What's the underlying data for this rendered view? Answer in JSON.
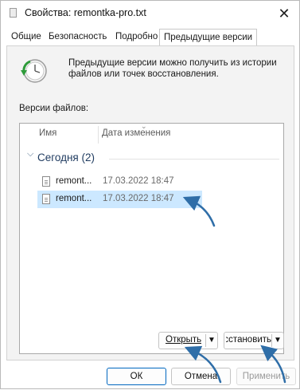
{
  "window": {
    "title": "Свойства: remontka-pro.txt",
    "close_glyph": "✕"
  },
  "tabs": [
    {
      "label": "Общие"
    },
    {
      "label": "Безопасность"
    },
    {
      "label": "Подробно"
    },
    {
      "label": "Предыдущие версии",
      "active": true
    }
  ],
  "panel": {
    "description": "Предыдущие версии можно получить из истории файлов или точек восстановления.",
    "versions_label": "Версии файлов:",
    "columns": [
      "Имя",
      "Дата изменения"
    ],
    "group": {
      "label": "Сегодня (2)"
    },
    "rows": [
      {
        "name": "remont...",
        "date": "17.03.2022 18:47",
        "selected": false
      },
      {
        "name": "remont...",
        "date": "17.03.2022 18:47",
        "selected": true
      }
    ],
    "open_button": "Открыть",
    "restore_button": "Восстановить"
  },
  "footer": {
    "ok": "ОК",
    "cancel": "Отмена",
    "apply": "Применить"
  },
  "colors": {
    "accent": "#0067c0",
    "selection": "#cce8ff",
    "annotation_arrow": "#2f6ea8"
  },
  "icons": [
    "file-icon",
    "restore-clock-icon",
    "chevron-down-icon",
    "close-icon"
  ]
}
